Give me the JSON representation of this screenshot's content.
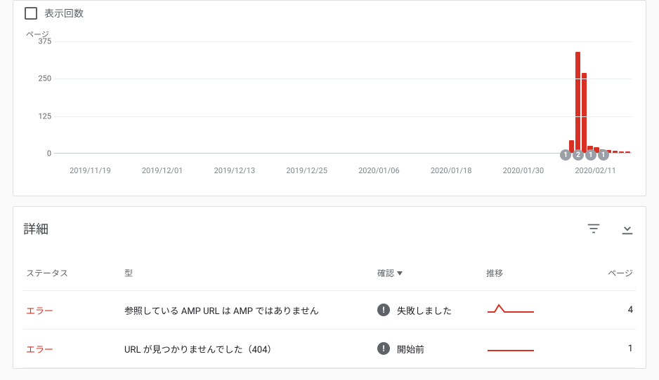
{
  "checkbox_label": "表示回数",
  "chart_data": {
    "type": "bar",
    "title": "ページ",
    "y_ticks": [
      0,
      125,
      250,
      375
    ],
    "x_ticks": [
      "2019/11/19",
      "2019/12/01",
      "2019/12/13",
      "2019/12/25",
      "2020/01/06",
      "2020/01/18",
      "2020/01/30",
      "2020/02/11"
    ],
    "n_slots": 92,
    "series": [
      {
        "slot": 82,
        "value": 45
      },
      {
        "slot": 83,
        "value": 340
      },
      {
        "slot": 84,
        "value": 270
      },
      {
        "slot": 85,
        "value": 25
      },
      {
        "slot": 86,
        "value": 22
      },
      {
        "slot": 87,
        "value": 15
      },
      {
        "slot": 88,
        "value": 12
      },
      {
        "slot": 89,
        "value": 10
      },
      {
        "slot": 90,
        "value": 8
      },
      {
        "slot": 91,
        "value": 6
      }
    ],
    "badges": [
      {
        "slot": 81,
        "label": "1"
      },
      {
        "slot": 83,
        "label": "2"
      },
      {
        "slot": 85,
        "label": "1"
      },
      {
        "slot": 87,
        "label": "1"
      }
    ],
    "ylim": [
      0,
      375
    ]
  },
  "details": {
    "title": "詳細",
    "columns": {
      "status": "ステータス",
      "type": "型",
      "validation": "確認",
      "trend": "推移",
      "pages": "ページ"
    },
    "rows": [
      {
        "status": "エラー",
        "type": "参照している AMP URL は AMP ではありません",
        "validation_text": "失敗しました",
        "trend_shape": "spike",
        "pages": "4"
      },
      {
        "status": "エラー",
        "type": "URL が見つかりませんでした（404）",
        "validation_text": "開始前",
        "trend_shape": "flat",
        "pages": "1"
      }
    ]
  }
}
